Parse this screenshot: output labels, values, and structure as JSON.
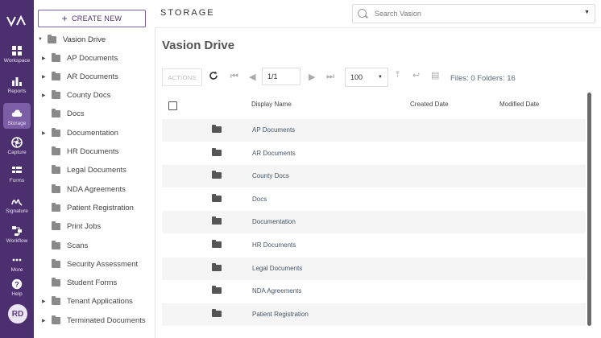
{
  "nav": {
    "logo": "VA",
    "items": [
      {
        "label": "Workspace",
        "icon": "grid-icon"
      },
      {
        "label": "Reports",
        "icon": "bar-chart-icon"
      },
      {
        "label": "Storage",
        "icon": "cloud-icon",
        "active": true
      },
      {
        "label": "Capture",
        "icon": "aperture-icon"
      },
      {
        "label": "Forms",
        "icon": "form-icon"
      },
      {
        "label": "Signature",
        "icon": "signature-icon"
      },
      {
        "label": "Workflow",
        "icon": "workflow-icon"
      },
      {
        "label": "More",
        "icon": "more-icon"
      },
      {
        "label": "Help",
        "icon": "help-icon"
      }
    ],
    "avatar": "RD"
  },
  "tree": {
    "create_label": "CREATE NEW",
    "root": "Vasion Drive",
    "items": [
      {
        "label": "AP Documents",
        "expandable": true
      },
      {
        "label": "AR Documents",
        "expandable": true
      },
      {
        "label": "County Docs",
        "expandable": true
      },
      {
        "label": "Docs",
        "expandable": false
      },
      {
        "label": "Documentation",
        "expandable": true
      },
      {
        "label": "HR Documents",
        "expandable": false
      },
      {
        "label": "Legal Documents",
        "expandable": false
      },
      {
        "label": "NDA Agreements",
        "expandable": false
      },
      {
        "label": "Patient Registration",
        "expandable": false
      },
      {
        "label": "Print Jobs",
        "expandable": false
      },
      {
        "label": "Scans",
        "expandable": false
      },
      {
        "label": "Security Assessment",
        "expandable": false
      },
      {
        "label": "Student Forms",
        "expandable": false
      },
      {
        "label": "Tenant Applications",
        "expandable": true
      },
      {
        "label": "Terminated Documents",
        "expandable": true
      }
    ]
  },
  "header": {
    "brand": "STORAGE",
    "search_placeholder": "Search Vasion"
  },
  "main": {
    "title": "Vasion Drive",
    "toolbar": {
      "actions_label": "ACTIONS",
      "page_value": "1/1",
      "page_size": "100",
      "counts": "Files: 0 Folders: 16"
    },
    "columns": [
      "Display Name",
      "Created Date",
      "Modified Date"
    ],
    "rows": [
      {
        "name": "AP Documents"
      },
      {
        "name": "AR Documents"
      },
      {
        "name": "County Docs"
      },
      {
        "name": "Docs"
      },
      {
        "name": "Documentation"
      },
      {
        "name": "HR Documents"
      },
      {
        "name": "Legal Documents"
      },
      {
        "name": "NDA Agreements"
      },
      {
        "name": "Patient Registration"
      }
    ]
  },
  "colors": {
    "rail": "#4b2f6e",
    "rail_active": "#7b5ea6",
    "accent": "#4b2f6e"
  }
}
